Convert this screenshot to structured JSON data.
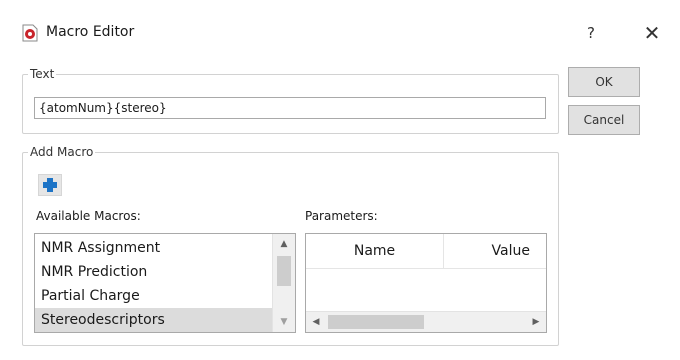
{
  "window": {
    "title": "Macro Editor",
    "help_label": "?",
    "close_label": "✕"
  },
  "text_group": {
    "legend": "Text",
    "value": "{atomNum}{stereo}"
  },
  "buttons": {
    "ok_label": "OK",
    "cancel_label": "Cancel"
  },
  "add_macro_group": {
    "legend": "Add Macro",
    "available_label": "Available Macros:",
    "parameters_label": "Parameters:",
    "macros": [
      {
        "label": "NMR Assignment",
        "selected": false
      },
      {
        "label": "NMR Prediction",
        "selected": false
      },
      {
        "label": "Partial Charge",
        "selected": false
      },
      {
        "label": "Stereodescriptors",
        "selected": true
      }
    ],
    "param_columns": [
      "Name",
      "Value"
    ]
  },
  "colors": {
    "add_icon": "#1e74c6",
    "app_icon_red": "#c8242b",
    "selection": "#dcdcdc"
  }
}
